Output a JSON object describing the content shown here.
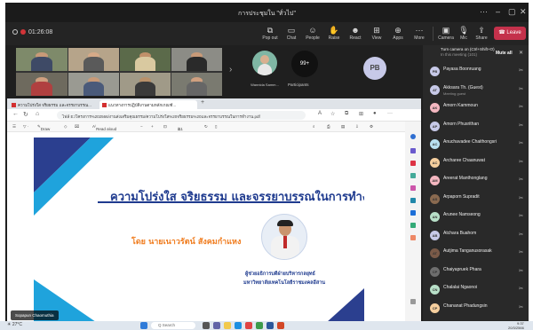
{
  "window": {
    "title": "การประชุมใน \"ทั่วไป\""
  },
  "toolbar": {
    "timer": "01:26:08",
    "items": [
      {
        "label": "Pop out",
        "icon": "popout-icon"
      },
      {
        "label": "Chat",
        "icon": "chat-icon"
      },
      {
        "label": "People",
        "icon": "people-icon"
      },
      {
        "label": "Raise",
        "icon": "raise-hand-icon"
      },
      {
        "label": "React",
        "icon": "react-icon"
      },
      {
        "label": "View",
        "icon": "view-icon"
      },
      {
        "label": "Apps",
        "icon": "apps-icon"
      },
      {
        "label": "More",
        "icon": "more-icon"
      },
      {
        "label": "Camera",
        "icon": "camera-off-icon"
      },
      {
        "label": "Mic",
        "icon": "mic-off-icon"
      },
      {
        "label": "Share",
        "icon": "share-icon"
      }
    ],
    "leave_label": "Leave"
  },
  "strip": {
    "person_name": "Wannida Samm...",
    "more_count": "99+",
    "more_label": "Participants",
    "pb_initials": "PB"
  },
  "browser": {
    "tabs": [
      "ความโปร่งใส จริยธรรม และจรรยาบรรณ...",
      "แนวทางการปฏิบัติงานตามหลักเกณฑ์..."
    ],
    "url": "ไฟล์  E:/โครงการ%202566/งานส่งเสริมคุณธรรม/ความโปร่งใส%20จริยธรรม%20และจรรยาบรรณในการทำงาน.pdf",
    "pdf": {
      "draw": "Draw",
      "read_aloud": "Read aloud",
      "page_current": "1",
      "page_total": "/11"
    }
  },
  "slide": {
    "title": "ความโปร่งใส จริยธรรม และจรรยาบรรณในการทำงาน",
    "by": "โดย นายเนาวรัตน์  สังคมกำแหง",
    "caption1": "ผู้ช่วยอธิการบดีฝ่ายบริหารกลยุทธ์",
    "caption2": "มหาวิทยาลัยเทคโนโลยีราชมงคลอีสาน",
    "presenter": "Sopapun Chaomuthia"
  },
  "panel": {
    "top_text": "Turn camera on (Ctrl+Shift+O)",
    "in_meeting": "In this meeting (101)",
    "mute_all": "Mute all",
    "participants": [
      {
        "initials": "PB",
        "name": "Payasa Boonruang",
        "sub": "",
        "color": "#c7c9e8"
      },
      {
        "initials": "AT",
        "name": "Akksara Th. (Guest)",
        "sub": "Meeting guest",
        "color": "#c7c9e8"
      },
      {
        "initials": "AK",
        "name": "Amorn Kammoun",
        "sub": "",
        "color": "#f4b7c0"
      },
      {
        "initials": "AP",
        "name": "Amorn Phusrithan",
        "sub": "",
        "color": "#c7c9e8"
      },
      {
        "initials": "AC",
        "name": "Anuchavadee Chaithongsri",
        "sub": "",
        "color": "#b8e0f0"
      },
      {
        "initials": "AC",
        "name": "Archaree Chaanuwat",
        "sub": "",
        "color": "#f6cf9e"
      },
      {
        "initials": "AM",
        "name": "Areerat Manthonglang",
        "sub": "",
        "color": "#f4b7c0"
      },
      {
        "initials": "AS",
        "name": "Arpaporn Supradit",
        "sub": "",
        "color": "#8a6a50"
      },
      {
        "initials": "AN",
        "name": "Arunee Namseong",
        "sub": "",
        "color": "#b8e0c8"
      },
      {
        "initials": "AB",
        "name": "Atchara Buahom",
        "sub": "",
        "color": "#c7c9e8"
      },
      {
        "initials": "AT",
        "name": "Autjima Tanganusorasak",
        "sub": "",
        "color": "#7a5a48"
      },
      {
        "initials": "CP",
        "name": "Chaiyapruek Phara",
        "sub": "",
        "color": "#6e6e6e"
      },
      {
        "initials": "CN",
        "name": "Chalalai Ngaonoi",
        "sub": "",
        "color": "#b8e0c8"
      },
      {
        "initials": "CP",
        "name": "Chananat Phadungsin",
        "sub": "",
        "color": "#f6cf9e"
      }
    ]
  },
  "taskbar": {
    "weather": "27°C",
    "search": "Q Search",
    "time": "9:37",
    "date": "20/3/2566"
  }
}
